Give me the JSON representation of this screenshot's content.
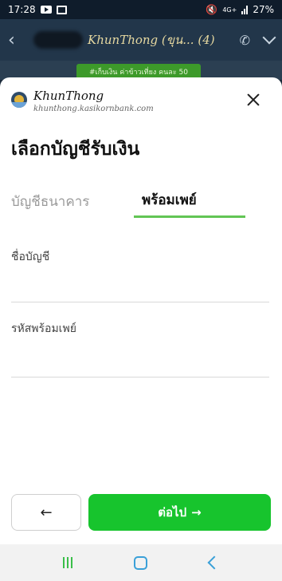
{
  "status_bar": {
    "time": "17:28",
    "network": "4G+",
    "battery": "27%",
    "icons": [
      "youtube-icon",
      "image-icon",
      "mute-icon",
      "signal-icon"
    ]
  },
  "chat_header": {
    "title": "KhunThong (ขุน... (4)",
    "icons": [
      "chevron-left-icon",
      "phone-icon",
      "chevron-down-icon"
    ]
  },
  "chat_banner": {
    "text": "#เก็บเงิน ค่าข้าวเที่ยง คนละ 50"
  },
  "sheet": {
    "brand": {
      "name": "KhunThong",
      "url": "khunthong.kasikornbank.com"
    },
    "title": "เลือกบัญชีรับเงิน",
    "tabs": [
      {
        "label": "บัญชีธนาคาร",
        "active": false
      },
      {
        "label": "พร้อมเพย์",
        "active": true
      }
    ],
    "fields": {
      "account_name": {
        "label": "ชื่อบัญชี",
        "value": ""
      },
      "promptpay_id": {
        "label": "รหัสพร้อมเพย์",
        "value": ""
      }
    },
    "buttons": {
      "back_arrow": "←",
      "next_label": "ต่อไป",
      "next_arrow": "→"
    }
  },
  "colors": {
    "accent_green": "#17c42d",
    "tab_underline": "#62c554"
  },
  "nav_bar": {
    "icons": [
      "recents-icon",
      "home-icon",
      "back-icon"
    ]
  }
}
